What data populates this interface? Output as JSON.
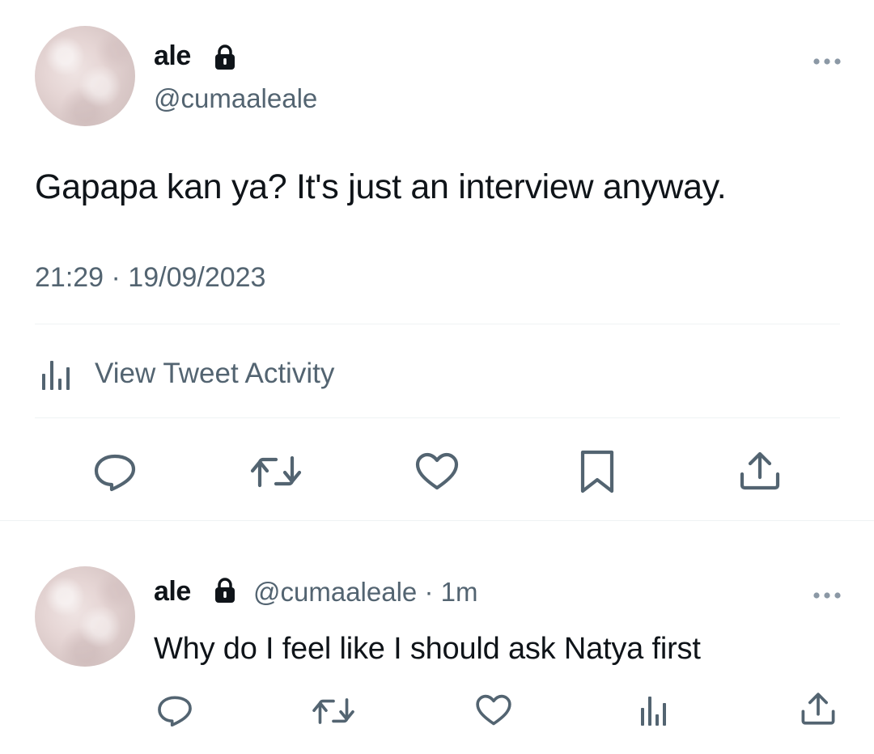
{
  "tweet": {
    "display_name": "ale",
    "handle": "@cumaaleale",
    "text": "Gapapa kan ya? It's just an interview anyway.",
    "timestamp": "21:29 · 19/09/2023",
    "activity_label": "View Tweet Activity",
    "more_icon": "more-horizontal-icon",
    "lock_icon": "lock-icon"
  },
  "actions": [
    "reply-icon",
    "retweet-icon",
    "like-icon",
    "bookmark-icon",
    "share-icon"
  ],
  "reply": {
    "display_name": "ale",
    "handle_time": "@cumaaleale · 1m",
    "text": "Why do I feel like I should ask Natya first",
    "actions": [
      "reply-icon",
      "retweet-icon",
      "like-icon",
      "views-icon",
      "share-icon"
    ]
  },
  "colors": {
    "text": "#0f1419",
    "secondary": "#536471",
    "divider": "#eff3f4"
  }
}
